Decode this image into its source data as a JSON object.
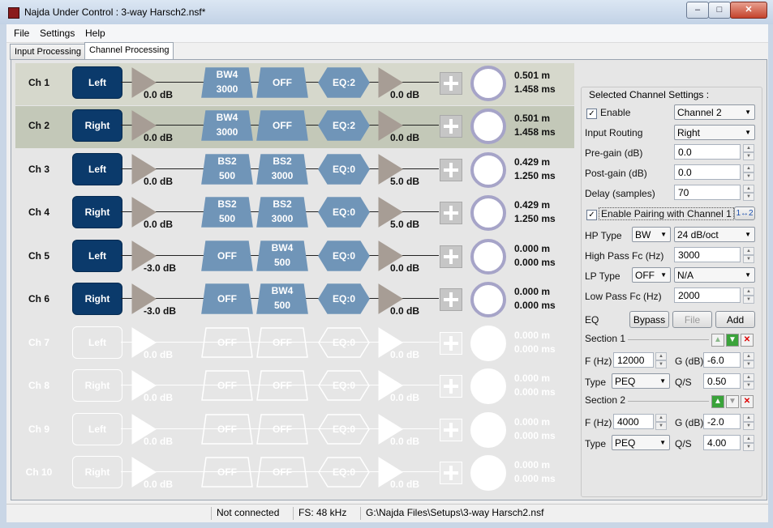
{
  "window": {
    "title": "Najda Under Control : 3-way Harsch2.nsf*",
    "minimize": "‒",
    "maximize": "□",
    "close": "✕"
  },
  "menu": [
    "File",
    "Settings",
    "Help"
  ],
  "tabs": [
    "Input Processing",
    "Channel Processing"
  ],
  "channels": [
    {
      "name": "Ch 1",
      "route": "Left",
      "pre_gain": "0.0 dB",
      "f1a": "BW4",
      "f1b": "3000",
      "f2": "OFF",
      "eq": "EQ:2",
      "post_gain": "0.0 dB",
      "dist": "0.501 m",
      "time": "1.458 ms"
    },
    {
      "name": "Ch 2",
      "route": "Right",
      "pre_gain": "0.0 dB",
      "f1a": "BW4",
      "f1b": "3000",
      "f2": "OFF",
      "eq": "EQ:2",
      "post_gain": "0.0 dB",
      "dist": "0.501 m",
      "time": "1.458 ms"
    },
    {
      "name": "Ch 3",
      "route": "Left",
      "pre_gain": "0.0 dB",
      "f1a": "BS2",
      "f1b": "500",
      "f2a": "BS2",
      "f2b": "3000",
      "eq": "EQ:0",
      "post_gain": "5.0 dB",
      "dist": "0.429 m",
      "time": "1.250 ms"
    },
    {
      "name": "Ch 4",
      "route": "Right",
      "pre_gain": "0.0 dB",
      "f1a": "BS2",
      "f1b": "500",
      "f2a": "BS2",
      "f2b": "3000",
      "eq": "EQ:0",
      "post_gain": "5.0 dB",
      "dist": "0.429 m",
      "time": "1.250 ms"
    },
    {
      "name": "Ch 5",
      "route": "Left",
      "pre_gain": "-3.0 dB",
      "f1": "OFF",
      "f2a": "BW4",
      "f2b": "500",
      "eq": "EQ:0",
      "post_gain": "0.0 dB",
      "dist": "0.000 m",
      "time": "0.000 ms"
    },
    {
      "name": "Ch 6",
      "route": "Right",
      "pre_gain": "-3.0 dB",
      "f1": "OFF",
      "f2a": "BW4",
      "f2b": "500",
      "eq": "EQ:0",
      "post_gain": "0.0 dB",
      "dist": "0.000 m",
      "time": "0.000 ms"
    },
    {
      "name": "Ch 7",
      "route": "Left",
      "pre_gain": "0.0 dB",
      "f1": "OFF",
      "f2": "OFF",
      "eq": "EQ:0",
      "post_gain": "0.0 dB",
      "dist": "0.000 m",
      "time": "0.000 ms"
    },
    {
      "name": "Ch 8",
      "route": "Right",
      "pre_gain": "0.0 dB",
      "f1": "OFF",
      "f2": "OFF",
      "eq": "EQ:0",
      "post_gain": "0.0 dB",
      "dist": "0.000 m",
      "time": "0.000 ms"
    },
    {
      "name": "Ch 9",
      "route": "Left",
      "pre_gain": "0.0 dB",
      "f1": "OFF",
      "f2": "OFF",
      "eq": "EQ:0",
      "post_gain": "0.0 dB",
      "dist": "0.000 m",
      "time": "0.000 ms"
    },
    {
      "name": "Ch 10",
      "route": "Right",
      "pre_gain": "0.0 dB",
      "f1": "OFF",
      "f2": "OFF",
      "eq": "EQ:0",
      "post_gain": "0.0 dB",
      "dist": "0.000 m",
      "time": "0.000 ms"
    }
  ],
  "settings": {
    "title": "Selected Channel Settings :",
    "enable_label": "Enable",
    "channel_select": "Channel 2",
    "input_routing_label": "Input Routing",
    "input_routing_value": "Right",
    "pre_gain_label": "Pre-gain (dB)",
    "pre_gain_value": "0.0",
    "post_gain_label": "Post-gain (dB)",
    "post_gain_value": "0.0",
    "delay_label": "Delay (samples)",
    "delay_value": "70",
    "pairing_label": "Enable Pairing with Channel 1",
    "pairing_icon": "1↔2",
    "hp_type_label": "HP Type",
    "hp_type_value": "BW",
    "hp_slope_value": "24 dB/oct",
    "hp_fc_label": "High Pass Fc (Hz)",
    "hp_fc_value": "3000",
    "lp_type_label": "LP Type",
    "lp_type_value": "OFF",
    "lp_slope_value": "N/A",
    "lp_fc_label": "Low Pass Fc (Hz)",
    "lp_fc_value": "2000",
    "eq_label": "EQ",
    "bypass_label": "Bypass",
    "file_label": "File",
    "add_label": "Add",
    "sections": [
      {
        "title": "Section 1",
        "f_label": "F (Hz)",
        "f_value": "12000",
        "g_label": "G (dB)",
        "g_value": "-6.0",
        "type_label": "Type",
        "type_value": "PEQ",
        "q_label": "Q/S",
        "q_value": "0.50"
      },
      {
        "title": "Section 2",
        "f_label": "F (Hz)",
        "f_value": "4000",
        "g_label": "G (dB)",
        "g_value": "-2.0",
        "type_label": "Type",
        "type_value": "PEQ",
        "q_label": "Q/S",
        "q_value": "4.00"
      }
    ]
  },
  "status": {
    "connection": "Not connected",
    "fs": "FS: 48 kHz",
    "path": "G:\\Najda Files\\Setups\\3-way Harsch2.nsf"
  }
}
